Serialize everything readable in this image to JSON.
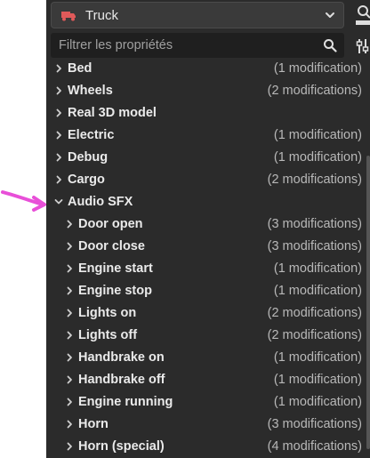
{
  "header": {
    "selected_object": "Truck",
    "search_placeholder": "Filtrer les propriétés"
  },
  "colors": {
    "panel_bg": "#2b2b2b",
    "truck_icon": "#e05a5a",
    "annotation": "#e84fd8"
  },
  "icons": {
    "object": "truck-icon",
    "dropdown": "chevron-down-icon",
    "dock": "dock-icon",
    "search": "search-icon",
    "filter": "filter-icon"
  },
  "tree": [
    {
      "label": "Bed",
      "mods": "(1 modification)",
      "level": 0,
      "expanded": false
    },
    {
      "label": "Wheels",
      "mods": "(2 modifications)",
      "level": 0,
      "expanded": false
    },
    {
      "label": "Real 3D model",
      "mods": "",
      "level": 0,
      "expanded": false
    },
    {
      "label": "Electric",
      "mods": "(1 modification)",
      "level": 0,
      "expanded": false
    },
    {
      "label": "Debug",
      "mods": "(1 modification)",
      "level": 0,
      "expanded": false
    },
    {
      "label": "Cargo",
      "mods": "(2 modifications)",
      "level": 0,
      "expanded": false
    },
    {
      "label": "Audio SFX",
      "mods": "",
      "level": 0,
      "expanded": true
    },
    {
      "label": "Door open",
      "mods": "(3 modifications)",
      "level": 1,
      "expanded": false
    },
    {
      "label": "Door close",
      "mods": "(3 modifications)",
      "level": 1,
      "expanded": false
    },
    {
      "label": "Engine start",
      "mods": "(1 modification)",
      "level": 1,
      "expanded": false
    },
    {
      "label": "Engine stop",
      "mods": "(1 modification)",
      "level": 1,
      "expanded": false
    },
    {
      "label": "Lights on",
      "mods": "(2 modifications)",
      "level": 1,
      "expanded": false
    },
    {
      "label": "Lights off",
      "mods": "(2 modifications)",
      "level": 1,
      "expanded": false
    },
    {
      "label": "Handbrake on",
      "mods": "(1 modification)",
      "level": 1,
      "expanded": false
    },
    {
      "label": "Handbrake off",
      "mods": "(1 modification)",
      "level": 1,
      "expanded": false
    },
    {
      "label": "Engine running",
      "mods": "(1 modification)",
      "level": 1,
      "expanded": false
    },
    {
      "label": "Horn",
      "mods": "(3 modifications)",
      "level": 1,
      "expanded": false
    },
    {
      "label": "Horn (special)",
      "mods": "(4 modifications)",
      "level": 1,
      "expanded": false
    }
  ]
}
